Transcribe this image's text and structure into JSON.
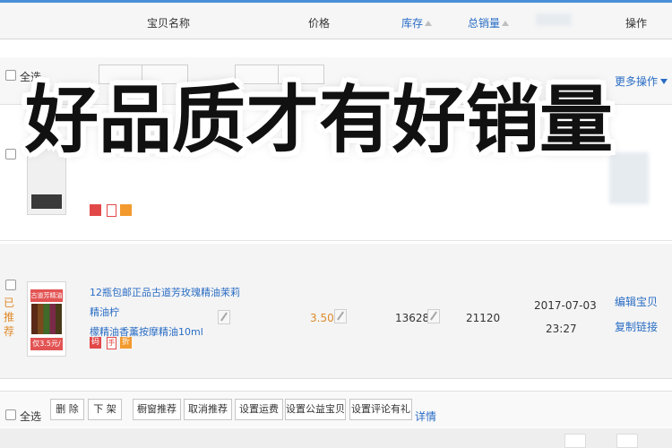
{
  "header": {
    "col_name": "宝贝名称",
    "col_price": "价格",
    "col_stock": "库存",
    "col_sales": "总销量",
    "col_ops": "操作"
  },
  "bulk_bar": {
    "select_all_label": "全选",
    "more_ops_label": "更多操作"
  },
  "overlay": {
    "headline": "好品质才有好销量"
  },
  "product": {
    "title_line1": "12瓶包邮正品古道芳玫瑰精油茉莉精油柠",
    "title_line2": "檬精油香薰按摩精油10ml",
    "thumb_band_text": "古道芳精油",
    "thumb_price_text": "仅3.5元/瓶",
    "status_text": "已推荐",
    "tag_code": "码",
    "tag_phone": "手",
    "tag_discount": "折",
    "price": "3.50",
    "stock": "13628",
    "sales": "21120",
    "list_date": "2017-07-03",
    "list_time": "23:27",
    "edit_link": "编辑宝贝",
    "copy_link": "复制链接"
  },
  "bottom_bar": {
    "select_all_label": "全选",
    "delete_label": "删 除",
    "delist_label": "下 架",
    "window_recommend_label": "橱窗推荐",
    "cancel_recommend_label": "取消推荐",
    "set_shipping_label": "设置运费",
    "set_charity_label": "设置公益宝贝",
    "set_review_gift_label": "设置评论有礼",
    "details_link": "详情"
  },
  "colors": {
    "link": "#2a6dc5",
    "price": "#e08a2a",
    "accent_line": "#4a90d9"
  }
}
